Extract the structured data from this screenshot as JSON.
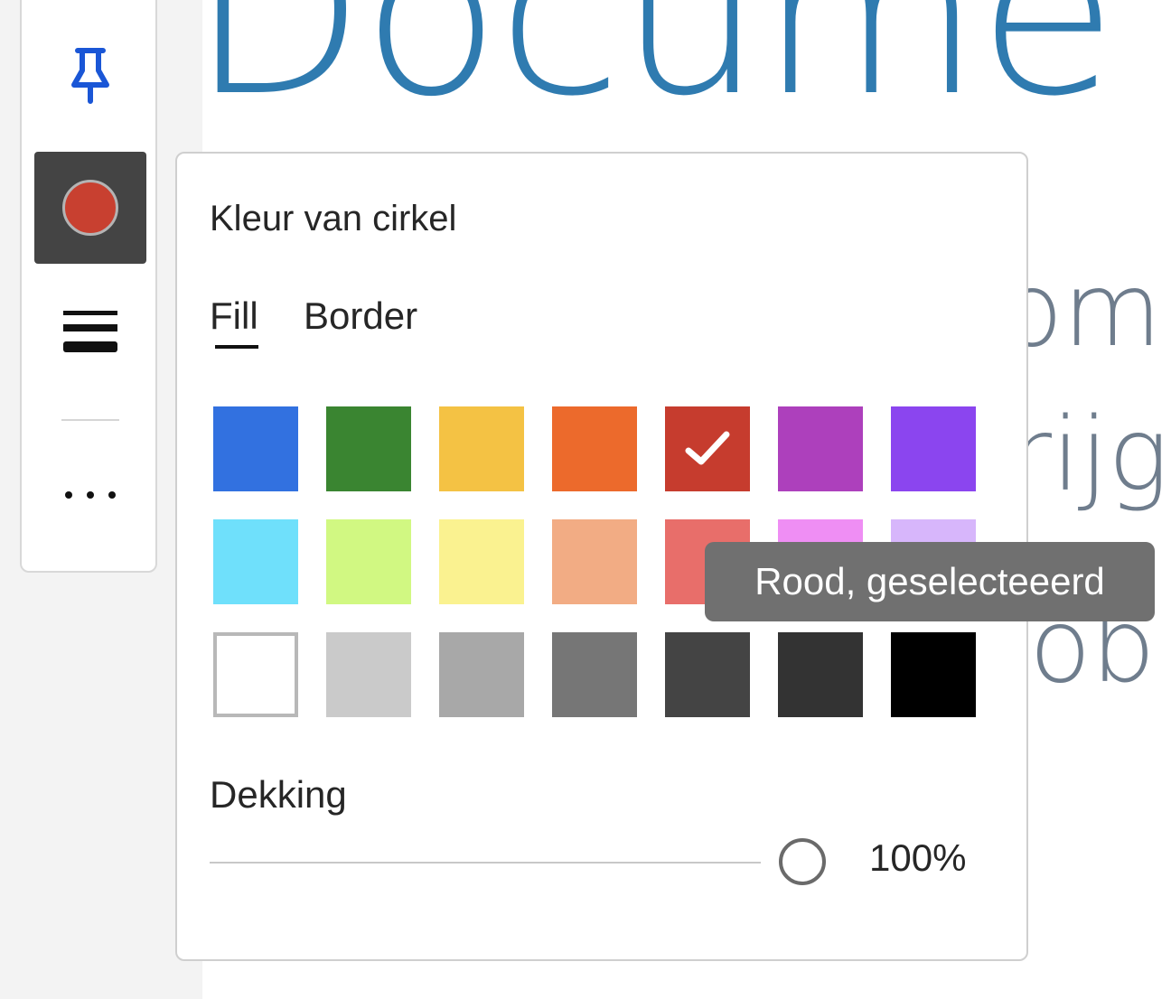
{
  "document": {
    "title_fragment": "Docume",
    "body_fragments": [
      "om",
      "rijg",
      "job"
    ]
  },
  "toolbar": {
    "pin_icon": "pin-icon",
    "current_fill_color": "#c84030",
    "weight_icon": "line-weight-icon",
    "more_label": "···"
  },
  "panel": {
    "title": "Kleur van cirkel",
    "tabs": [
      {
        "label": "Fill",
        "selected": true
      },
      {
        "label": "Border",
        "selected": false
      }
    ],
    "swatches": [
      [
        {
          "color": "#3271e0",
          "selected": false
        },
        {
          "color": "#3a8531",
          "selected": false
        },
        {
          "color": "#f4c244",
          "selected": false
        },
        {
          "color": "#ec6a2c",
          "selected": false
        },
        {
          "color": "#c63c2e",
          "selected": true
        },
        {
          "color": "#ad40bc",
          "selected": false
        },
        {
          "color": "#8b45ef",
          "selected": false
        }
      ],
      [
        {
          "color": "#6fe0fb",
          "selected": false
        },
        {
          "color": "#d1f882",
          "selected": false
        },
        {
          "color": "#faf290",
          "selected": false
        },
        {
          "color": "#f2ac84",
          "selected": false
        },
        {
          "color": "#e86e6a",
          "selected": false
        },
        {
          "color": "#ef8ef4",
          "selected": false
        },
        {
          "color": "#d7b6fb",
          "selected": false
        }
      ],
      [
        {
          "color": "#ffffff",
          "selected": false
        },
        {
          "color": "#cacaca",
          "selected": false
        },
        {
          "color": "#a8a8a8",
          "selected": false
        },
        {
          "color": "#767676",
          "selected": false
        },
        {
          "color": "#444444",
          "selected": false
        },
        {
          "color": "#333333",
          "selected": false
        },
        {
          "color": "#000000",
          "selected": false
        }
      ]
    ],
    "opacity_label": "Dekking",
    "opacity_percent": 100,
    "opacity_value_text": "100%",
    "tooltip": "Rood, geselecteeerd"
  }
}
